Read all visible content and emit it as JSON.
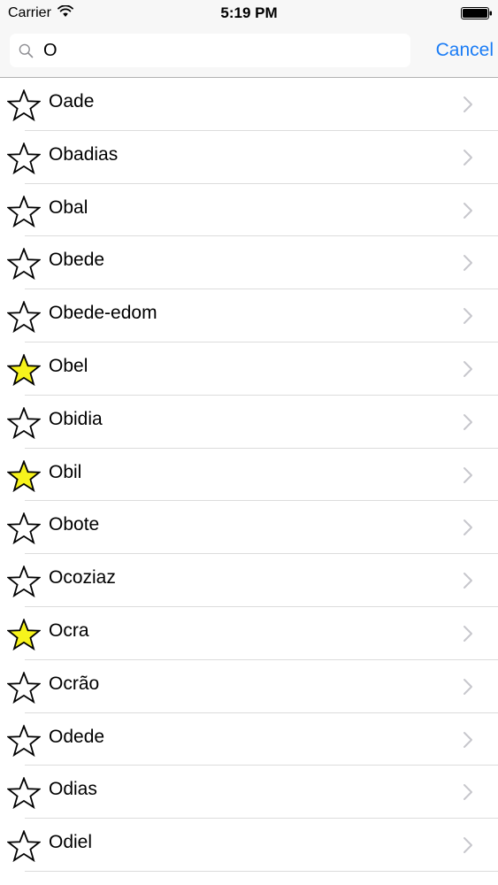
{
  "status_bar": {
    "carrier": "Carrier",
    "time": "5:19 PM",
    "wifi_icon": "wifi-icon",
    "battery_icon": "battery-icon"
  },
  "search": {
    "value": "O",
    "icon": "search-icon",
    "cancel_label": "Cancel"
  },
  "colors": {
    "accent": "#1a7cf5",
    "star_favorite": "#f7f31c",
    "star_outline": "#000000"
  },
  "results": [
    {
      "name": "Oade",
      "favorite": false
    },
    {
      "name": "Obadias",
      "favorite": false
    },
    {
      "name": "Obal",
      "favorite": false
    },
    {
      "name": "Obede",
      "favorite": false
    },
    {
      "name": "Obede-edom",
      "favorite": false
    },
    {
      "name": "Obel",
      "favorite": true
    },
    {
      "name": "Obidia",
      "favorite": false
    },
    {
      "name": "Obil",
      "favorite": true
    },
    {
      "name": "Obote",
      "favorite": false
    },
    {
      "name": "Ocoziaz",
      "favorite": false
    },
    {
      "name": "Ocra",
      "favorite": true
    },
    {
      "name": "Ocrão",
      "favorite": false
    },
    {
      "name": "Odede",
      "favorite": false
    },
    {
      "name": "Odias",
      "favorite": false
    },
    {
      "name": "Odiel",
      "favorite": false
    }
  ]
}
